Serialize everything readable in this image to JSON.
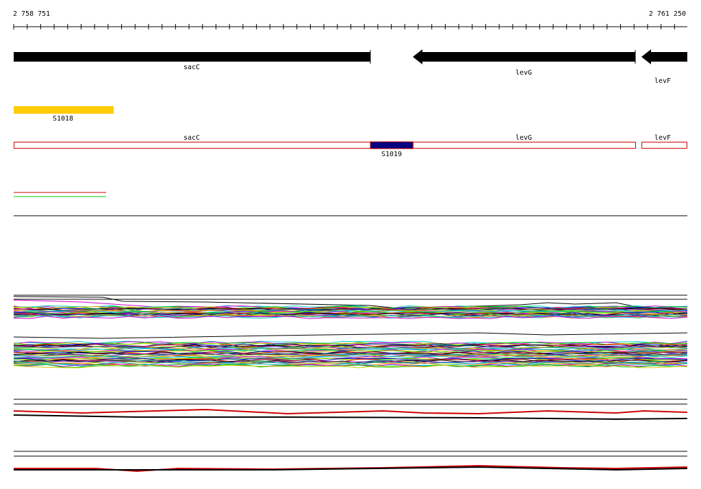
{
  "coordinates": {
    "start": "2 758 751",
    "end": "2 761 250"
  },
  "genes": [
    {
      "name": "sacC",
      "strand": "forward"
    },
    {
      "name": "levG",
      "strand": "reverse"
    },
    {
      "name": "levF",
      "strand": "reverse"
    }
  ],
  "features": {
    "S1018": {
      "label": "S1018",
      "color": "#ffcc00"
    },
    "S1019": {
      "label": "S1019",
      "color": "#000080"
    }
  },
  "colors": {
    "gene_arrow": "#000000",
    "transcript_outline": "#cc0000",
    "legend_line_1": "#cc0000",
    "legend_line_2": "#00cc00"
  }
}
